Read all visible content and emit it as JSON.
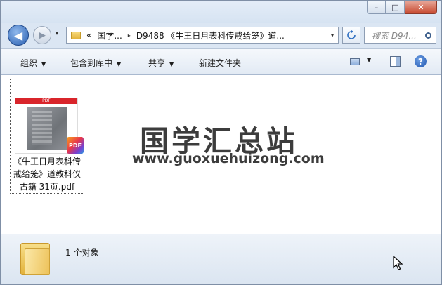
{
  "window": {
    "caption_min": "–",
    "caption_max": "□",
    "caption_close": "✕"
  },
  "nav": {
    "back_glyph": "◀",
    "forward_glyph": "▶",
    "dropdown_glyph": "▾"
  },
  "address": {
    "overflow": "«",
    "crumbs": [
      "国学...",
      "D9488 《牛王日月表科传戒给笼》道..."
    ],
    "separator": "▸"
  },
  "search": {
    "placeholder": "搜索 D94..."
  },
  "toolbar": {
    "organize": "组织",
    "include_in_library": "包含到库中",
    "share": "共享",
    "new_folder": "新建文件夹",
    "help_glyph": "?"
  },
  "file": {
    "badge_text": "PDF",
    "corner_badge": "PDF",
    "name_lines": [
      "《牛王日月表科传",
      "戒给笼》道教科仪",
      "古籍 31页.pdf"
    ]
  },
  "watermark": {
    "title": "国学汇总站",
    "url": "www.guoxuehuizong.com"
  },
  "status": {
    "count": "1 个对象"
  },
  "icons": {
    "back": "back-arrow-icon",
    "forward": "forward-arrow-icon",
    "refresh": "refresh-icon",
    "search": "search-icon",
    "views": "change-view-icon",
    "preview_pane": "preview-pane-icon",
    "help": "help-icon",
    "folder": "folder-icon",
    "pdf": "pdf-file-icon",
    "cursor": "mouse-cursor-icon"
  },
  "colors": {
    "close_button": "#c84b31",
    "accent_blue": "#2a5fb0",
    "pdf_red": "#d9252b"
  }
}
